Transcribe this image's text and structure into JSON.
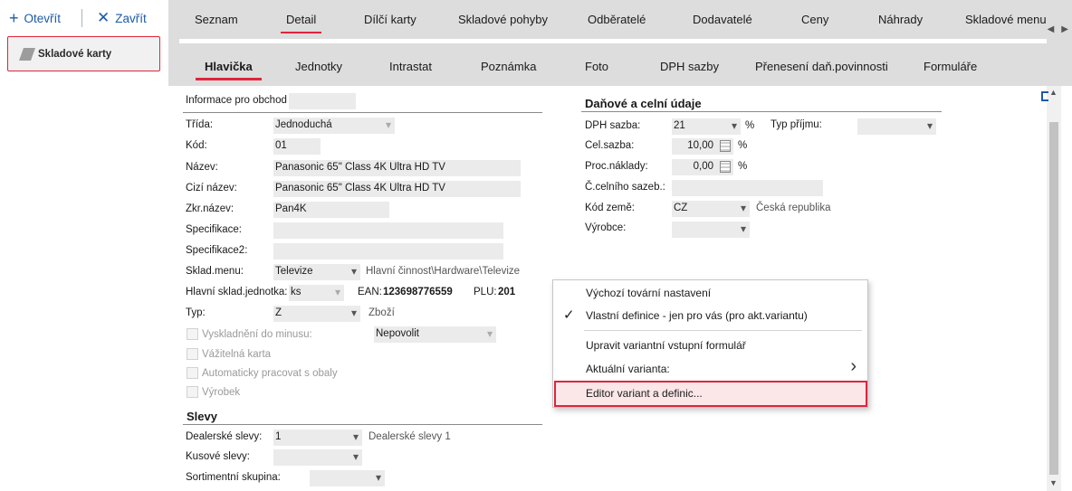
{
  "toolbar": {
    "open_label": "Otevřít",
    "close_label": "Zavřít"
  },
  "nav": {
    "card_label": "Skladové karty"
  },
  "main_tabs": [
    "Seznam",
    "Detail",
    "Dílčí karty",
    "Skladové pohyby",
    "Odběratelé",
    "Dodavatelé",
    "Ceny",
    "Náhrady",
    "Skladové menu"
  ],
  "sub_tabs": [
    "Hlavička",
    "Jednotky",
    "Intrastat",
    "Poznámka",
    "Foto",
    "DPH sazby",
    "Přenesení daň.povinnosti",
    "Formuláře"
  ],
  "form": {
    "info_label": "Informace pro obchod",
    "trida_label": "Třída:",
    "trida_value": "Jednoduchá",
    "kod_label": "Kód:",
    "kod_value": "01",
    "nazev_label": "Název:",
    "nazev_value": "Panasonic 65\" Class 4K Ultra HD TV",
    "cizi_label": "Cizí název:",
    "cizi_value": "Panasonic 65\" Class 4K Ultra HD TV",
    "zkr_label": "Zkr.název:",
    "zkr_value": "Pan4K",
    "spec_label": "Specifikace:",
    "spec2_label": "Specifikace2:",
    "sklmenu_label": "Sklad.menu:",
    "sklmenu_value": "Televize",
    "sklmenu_path": "Hlavní činnost\\Hardware\\Televize",
    "jednotka_label": "Hlavní sklad.jednotka:",
    "jednotka_value": "ks",
    "ean_label": "EAN:",
    "ean_value": "123698776559",
    "plu_label": "PLU:",
    "plu_value": "201",
    "typ_label": "Typ:",
    "typ_value": "Z",
    "typ_desc": "Zboží",
    "vyskladneni_label": "Vyskladnění do minusu:",
    "vyskladneni_value": "Nepovolit",
    "vazitelna_label": "Vážitelná karta",
    "obaly_label": "Automaticky pracovat s obaly",
    "vyrobek_label": "Výrobek",
    "slevy_header": "Slevy",
    "dealer_label": "Dealerské slevy:",
    "dealer_value": "1",
    "dealer_desc": "Dealerské slevy 1",
    "kusove_label": "Kusové slevy:",
    "sortiment_label": "Sortimentní skupina:"
  },
  "tax": {
    "header": "Daňové a celní údaje",
    "dph_label": "DPH sazba:",
    "dph_value": "21",
    "pct1": "%",
    "typ_prijmu_label": "Typ příjmu:",
    "cel_label": "Cel.sazba:",
    "cel_value": "10,00",
    "pct2": "%",
    "proc_label": "Proc.náklady:",
    "proc_value": "0,00",
    "pct3": "%",
    "celni_label": "Č.celního sazeb.:",
    "zeme_label": "Kód země:",
    "zeme_value": "CZ",
    "zeme_desc": "Česká republika",
    "vyrobce_label": "Výrobce:"
  },
  "context_menu": {
    "items": [
      "Výchozí tovární nastavení",
      "Vlastní definice - jen pro vás (pro akt.variantu)",
      "Upravit variantní vstupní formulář",
      "Aktuální varianta:",
      "Editor variant a definic..."
    ],
    "check_mark": "✓",
    "submenu_arrow": "›"
  },
  "colors": {
    "accent": "#e0243e",
    "link": "#1d5aa8",
    "tab_bg": "#dddddd",
    "field_bg": "#ebebeb"
  }
}
